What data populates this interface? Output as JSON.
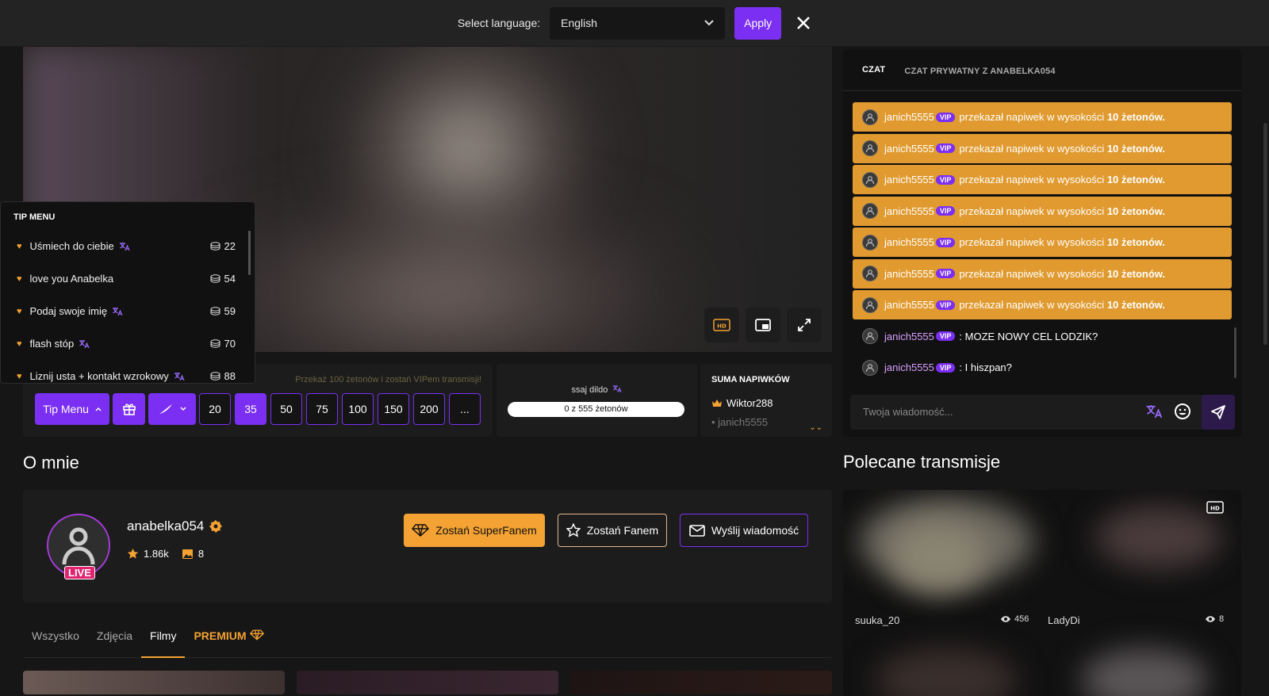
{
  "langbar": {
    "label": "Select language:",
    "value": "English",
    "apply": "Apply"
  },
  "tipmenu": {
    "title": "TIP MENU",
    "items": [
      {
        "label": "Uśmiech do ciebie",
        "amount": "22"
      },
      {
        "label": "love you Anabelka",
        "amount": "54"
      },
      {
        "label": "Podaj swoje imię",
        "amount": "59"
      },
      {
        "label": "flash stóp",
        "amount": "70"
      },
      {
        "label": "Liznij usta + kontakt wzrokowy",
        "amount": "88"
      }
    ]
  },
  "tipbar": {
    "hint": "Przekaż 100 żetonów i zostań VIPem transmisji!",
    "tip_menu": "Tip Menu",
    "amounts": [
      "20",
      "35",
      "50",
      "75",
      "100",
      "150",
      "200",
      "..."
    ]
  },
  "goal": {
    "title": "ssaj dildo",
    "progress_text": "0 z 555 żetonów"
  },
  "tips_sum": {
    "title": "SUMA NAPIWKÓW",
    "top": "Wiktor288",
    "second": "janich5555"
  },
  "chat": {
    "tabs": [
      "CZAT",
      "CZAT PRYWATNY Z ANABELKA054"
    ],
    "tip_messages": [
      {
        "user": "janich5555",
        "badge": "VIP",
        "text": "przekazał napiwek w wysokości",
        "amount": "10 żetonów."
      },
      {
        "user": "janich5555",
        "badge": "VIP",
        "text": "przekazał napiwek w wysokości",
        "amount": "10 żetonów."
      },
      {
        "user": "janich5555",
        "badge": "VIP",
        "text": "przekazał napiwek w wysokości",
        "amount": "10 żetonów."
      },
      {
        "user": "janich5555",
        "badge": "VIP",
        "text": "przekazał napiwek w wysokości",
        "amount": "10 żetonów."
      },
      {
        "user": "janich5555",
        "badge": "VIP",
        "text": "przekazał napiwek w wysokości",
        "amount": "10 żetonów."
      },
      {
        "user": "janich5555",
        "badge": "VIP",
        "text": "przekazał napiwek w wysokości",
        "amount": "10 żetonów."
      },
      {
        "user": "janich5555",
        "badge": "VIP",
        "text": "przekazał napiwek w wysokości",
        "amount": "10 żetonów."
      }
    ],
    "text_messages": [
      {
        "user": "janich5555",
        "badge": "VIP",
        "text": ": MOZE NOWY CEL LODZIK?"
      },
      {
        "user": "janich5555",
        "badge": "VIP",
        "text": ": I hiszpan?"
      }
    ],
    "input_placeholder": "Twoja wiadomość..."
  },
  "about": {
    "heading": "O mnie",
    "name": "anabelka054",
    "live": "LIVE",
    "followers": "1.86k",
    "photos": "8",
    "btn_superfan": "Zostań SuperFanem",
    "btn_fan": "Zostań Fanem",
    "btn_message": "Wyślij wiadomość"
  },
  "media_tabs": [
    "Wszystko",
    "Zdjęcia",
    "Filmy",
    "PREMIUM"
  ],
  "recommended": {
    "heading": "Polecane transmisje",
    "streams": [
      {
        "name": "suuka_20",
        "viewers": "456"
      },
      {
        "name": "LadyDi",
        "viewers": "8"
      }
    ],
    "hd": "HD"
  },
  "colors": {
    "accent": "#7b2ff2",
    "gold": "#f3a233",
    "tip_bg": "#e09a2f"
  }
}
